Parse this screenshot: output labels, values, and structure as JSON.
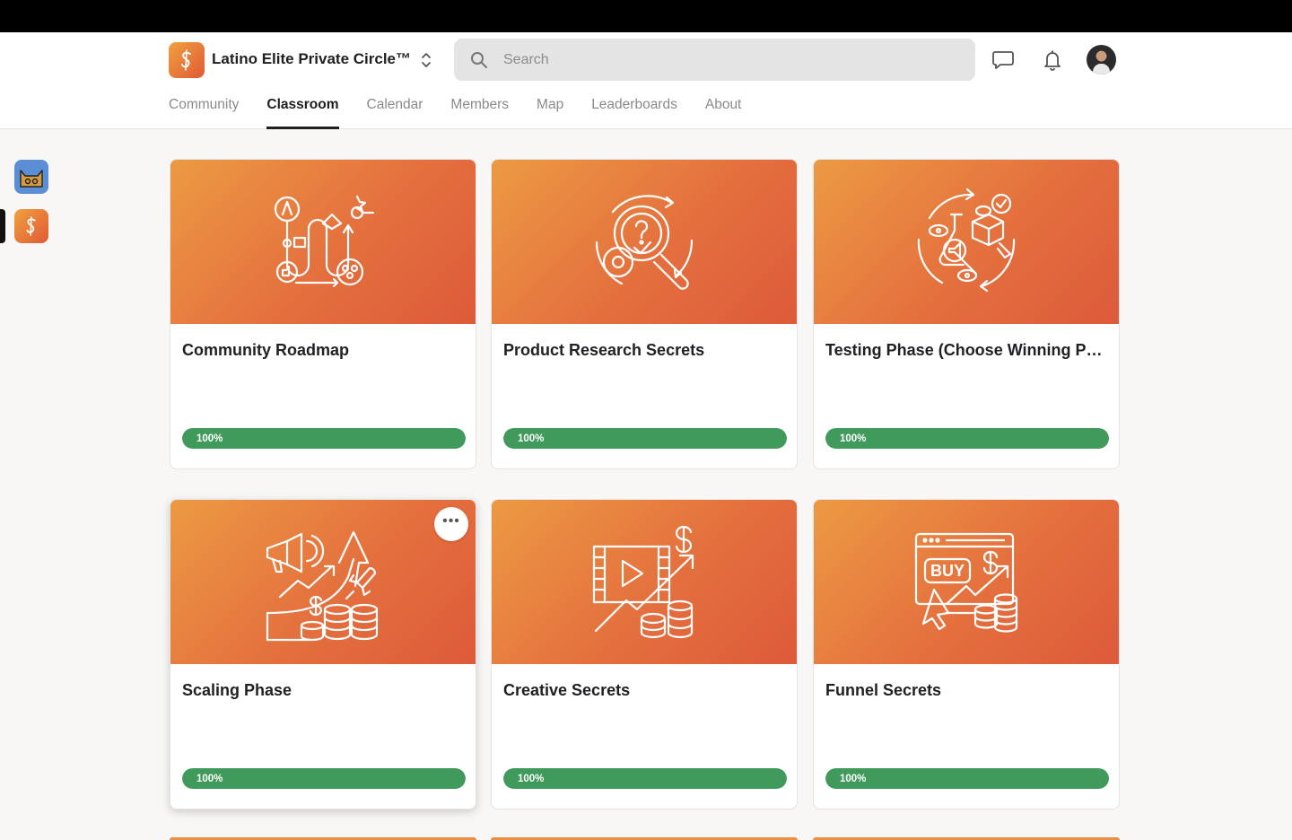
{
  "header": {
    "group_name": "Latino Elite Private Circle™",
    "search_placeholder": "Search"
  },
  "nav": {
    "tabs": [
      {
        "label": "Community",
        "active": false
      },
      {
        "label": "Classroom",
        "active": true
      },
      {
        "label": "Calendar",
        "active": false
      },
      {
        "label": "Members",
        "active": false
      },
      {
        "label": "Map",
        "active": false
      },
      {
        "label": "Leaderboards",
        "active": false
      },
      {
        "label": "About",
        "active": false
      }
    ]
  },
  "courses": [
    {
      "title": "Community Roadmap",
      "progress": 100,
      "progress_label": "100%",
      "icon": "roadmap-icon"
    },
    {
      "title": "Product Research Secrets",
      "progress": 100,
      "progress_label": "100%",
      "icon": "research-magnifier-icon"
    },
    {
      "title": "Testing Phase (Choose Winning P…",
      "progress": 100,
      "progress_label": "100%",
      "icon": "testing-cycle-icon"
    },
    {
      "title": "Scaling Phase",
      "progress": 100,
      "progress_label": "100%",
      "icon": "scaling-rocket-icon"
    },
    {
      "title": "Creative Secrets",
      "progress": 100,
      "progress_label": "100%",
      "icon": "video-growth-icon"
    },
    {
      "title": "Funnel Secrets",
      "progress": 100,
      "progress_label": "100%",
      "icon": "buy-funnel-icon"
    }
  ],
  "colors": {
    "cover_start": "#ec9a43",
    "cover_end": "#dd5a3a",
    "progress": "#3f9a5b"
  }
}
